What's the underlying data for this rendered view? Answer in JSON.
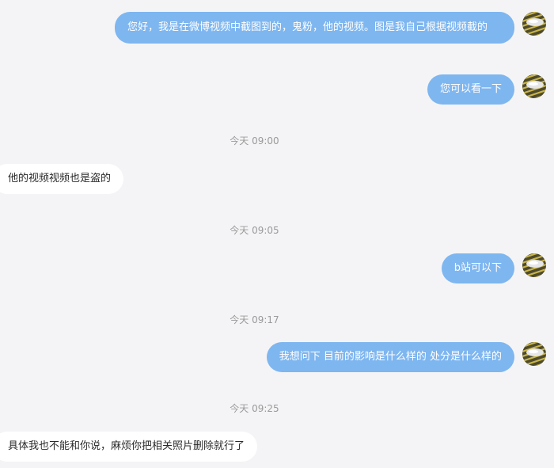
{
  "messages": [
    {
      "side": "out",
      "text": "您好，我是在微博视频中截图到的，鬼粉，他的视频。图是我自己根据视频截的"
    },
    {
      "side": "out",
      "text": "您可以看一下"
    },
    {
      "type": "time",
      "text": "今天 09:00"
    },
    {
      "side": "in",
      "text": "他的视频视频也是盗的"
    },
    {
      "type": "time",
      "text": "今天 09:05"
    },
    {
      "side": "out",
      "text": "b站可以下"
    },
    {
      "type": "time",
      "text": "今天 09:17"
    },
    {
      "side": "out",
      "text": "我想问下 目前的影响是什么样的 处分是什么样的"
    },
    {
      "type": "time",
      "text": "今天 09:25"
    },
    {
      "side": "in",
      "text": "具体我也不能和你说，麻烦你把相关照片删除就行了"
    }
  ],
  "colors": {
    "background": "#f4f4f6",
    "outgoing_bubble": "#7eb6f0",
    "incoming_bubble": "#ffffff",
    "timestamp_text": "#9a9a9a"
  },
  "icons": {
    "user_avatar": "user-avatar-icon"
  }
}
